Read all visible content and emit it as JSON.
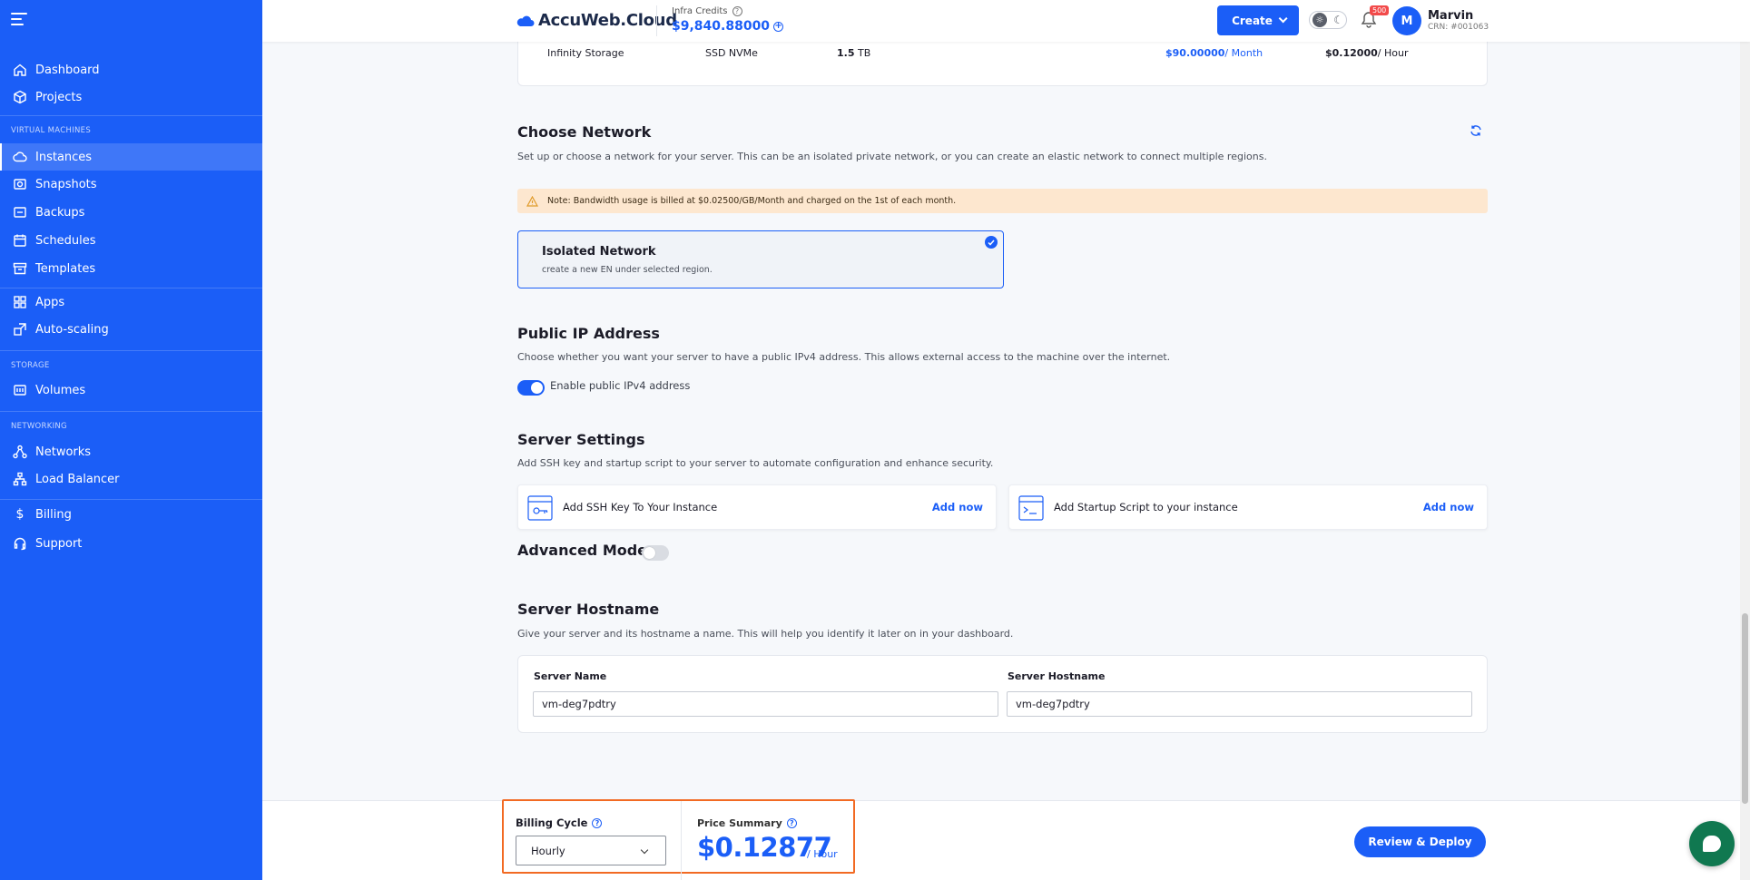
{
  "sidebar": {
    "items": [
      {
        "label": "Dashboard",
        "icon": "home-icon"
      },
      {
        "label": "Projects",
        "icon": "cube-icon"
      },
      {
        "label": "Instances",
        "icon": "cloud-icon",
        "active": true
      },
      {
        "label": "Snapshots",
        "icon": "snapshot-icon"
      },
      {
        "label": "Backups",
        "icon": "backup-icon"
      },
      {
        "label": "Schedules",
        "icon": "calendar-icon"
      },
      {
        "label": "Templates",
        "icon": "archive-icon"
      },
      {
        "label": "Apps",
        "icon": "grid-icon"
      },
      {
        "label": "Auto-scaling",
        "icon": "scale-icon"
      },
      {
        "label": "Volumes",
        "icon": "volume-icon"
      },
      {
        "label": "Networks",
        "icon": "network-icon"
      },
      {
        "label": "Load Balancer",
        "icon": "balancer-icon"
      },
      {
        "label": "Billing",
        "icon": "dollar-icon"
      },
      {
        "label": "Support",
        "icon": "headset-icon"
      }
    ],
    "sections": {
      "virtual_machines": "VIRTUAL MACHINES",
      "storage": "STORAGE",
      "networking": "NETWORKING"
    }
  },
  "header": {
    "logo": "AccuWeb.Cloud",
    "credits_label": "Infra Credits",
    "credits_value": "$9,840.88000",
    "create_label": "Create",
    "notification_count": "500",
    "avatar_initial": "M",
    "user_name": "Marvin",
    "user_crn": "CRN: #001063"
  },
  "storage_row": {
    "name": "Infinity Storage",
    "type": "SSD NVMe",
    "size_value": "1.5",
    "size_unit": "TB",
    "monthly_value": "$90.00000",
    "monthly_unit": "/ Month",
    "hourly_value": "$0.12000",
    "hourly_unit": "/ Hour"
  },
  "network": {
    "title": "Choose Network",
    "desc": "Set up or choose a network for your server. This can be an isolated private network, or you can create an elastic network to connect multiple regions.",
    "note": "Note: Bandwidth usage is billed at $0.02500/GB/Month and charged on the 1st of each month.",
    "option_title": "Isolated Network",
    "option_desc": "create a new EN under selected region."
  },
  "public_ip": {
    "title": "Public IP Address",
    "desc": "Choose whether you want your server to have a public IPv4 address. This allows external access to the machine over the internet.",
    "toggle_label": "Enable public IPv4 address"
  },
  "server_settings": {
    "title": "Server Settings",
    "desc": "Add SSH key and startup script to your server to automate configuration and enhance security.",
    "ssh_label": "Add SSH Key To Your Instance",
    "ssh_link": "Add now",
    "script_label": "Add Startup Script to your instance",
    "script_link": "Add now"
  },
  "advanced_mode": {
    "title": "Advanced Mode"
  },
  "hostname": {
    "title": "Server Hostname",
    "desc": "Give your server and its hostname a name. This will help you identify it later on in your dashboard.",
    "server_name_label": "Server Name",
    "server_name_value": "vm-deg7pdtry",
    "server_hostname_label": "Server Hostname",
    "server_hostname_value": "vm-deg7pdtry"
  },
  "footer": {
    "billing_cycle_label": "Billing Cycle",
    "billing_cycle_value": "Hourly",
    "price_summary_label": "Price Summary",
    "price_value": "$0.12877",
    "price_unit": "/ Hour",
    "deploy_label": "Review & Deploy"
  },
  "colors": {
    "primary": "#1b5ef7",
    "note_bg": "#fde7cf",
    "highlight": "#f26a23",
    "chat": "#107850"
  }
}
